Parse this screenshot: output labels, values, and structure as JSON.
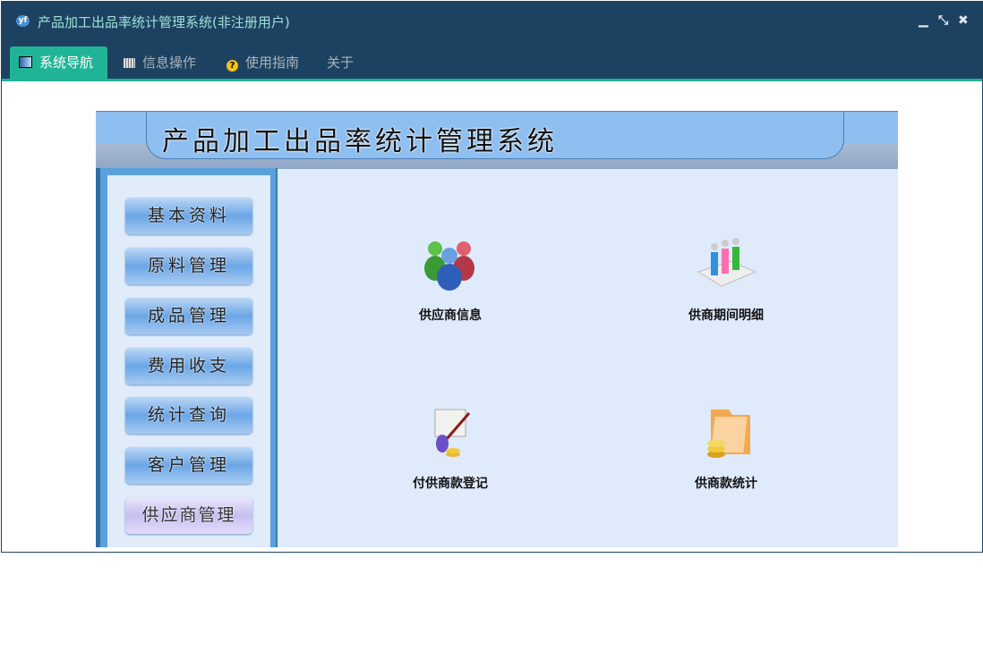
{
  "window": {
    "title": "产品加工出品率统计管理系统(非注册用户)",
    "app_icon": "yf-logo-icon",
    "controls": [
      "minimize",
      "restore",
      "close"
    ]
  },
  "tabs": [
    {
      "label": "系统导航",
      "icon": "monitor-icon",
      "active": true
    },
    {
      "label": "信息操作",
      "icon": "grid-icon"
    },
    {
      "label": "使用指南",
      "icon": "help-icon"
    },
    {
      "label": "关于"
    }
  ],
  "banner": {
    "title": "产品加工出品率统计管理系统"
  },
  "menu": [
    "基本资料",
    "原料管理",
    "成品管理",
    "费用收支",
    "统计查询",
    "客户管理",
    "供应商管理"
  ],
  "menu_selected": "供应商管理",
  "functions": [
    {
      "label": "供应商信息",
      "icon": "people-icon"
    },
    {
      "label": "供商期间明细",
      "icon": "group-chart-icon"
    },
    {
      "label": "付供商款登记",
      "icon": "payment-scroll-icon"
    },
    {
      "label": "供商款统计",
      "icon": "folder-coins-icon"
    }
  ]
}
